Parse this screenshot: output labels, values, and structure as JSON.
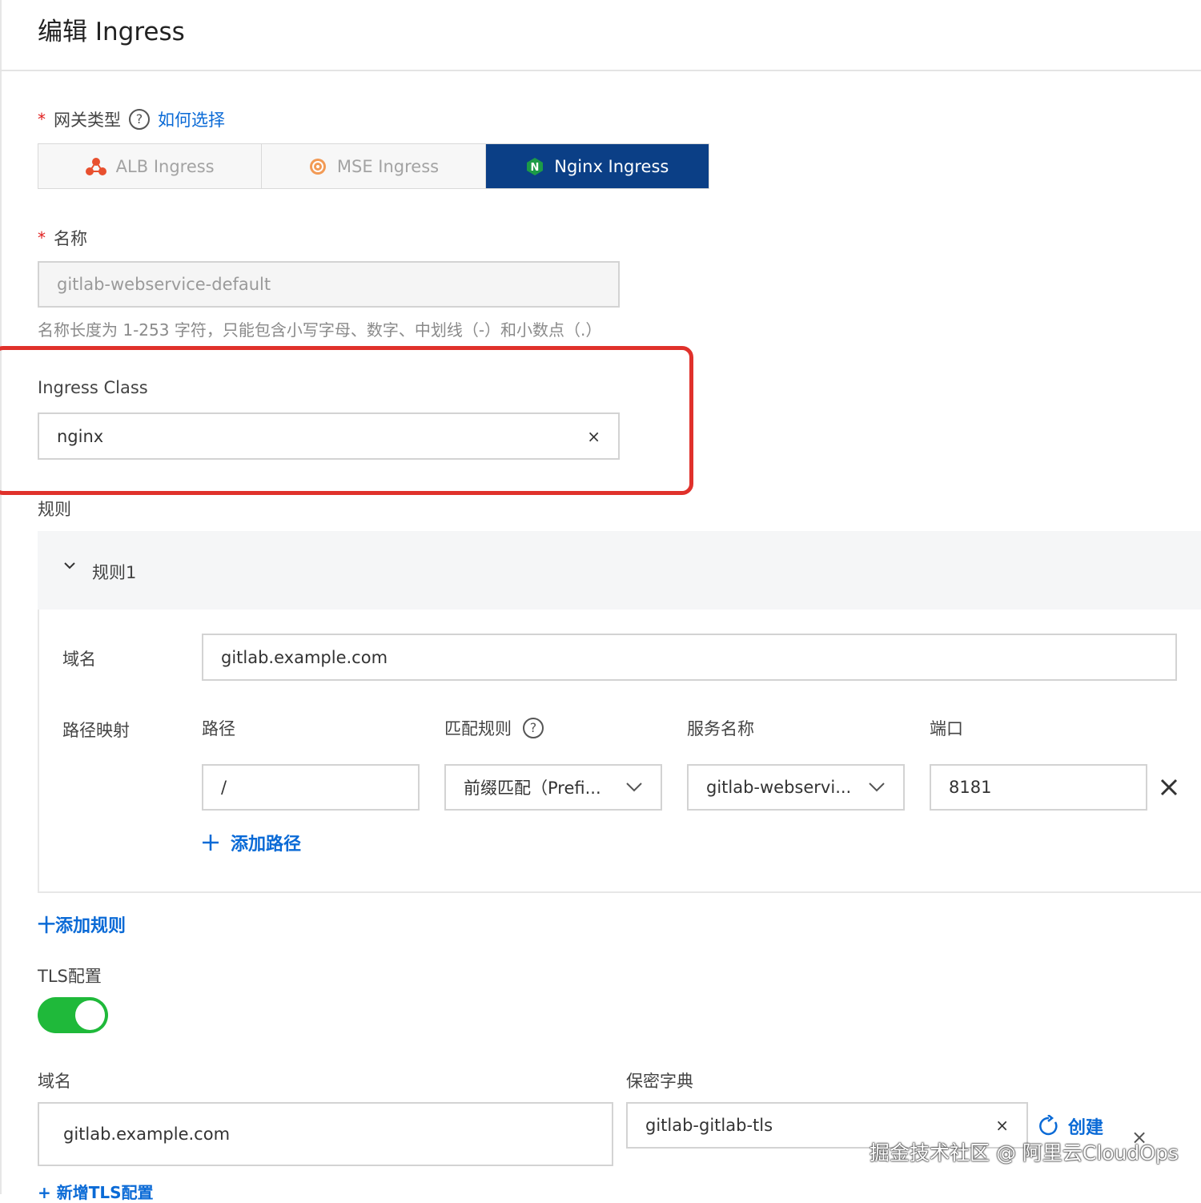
{
  "header": {
    "title": "编辑 Ingress"
  },
  "gateway": {
    "required_mark": "*",
    "label": "网关类型",
    "help_link": "如何选择",
    "tabs": [
      {
        "label": "ALB Ingress",
        "icon": "alb-icon",
        "active": false
      },
      {
        "label": "MSE Ingress",
        "icon": "mse-icon",
        "active": false
      },
      {
        "label": "Nginx Ingress",
        "icon": "nginx-icon",
        "active": true
      }
    ]
  },
  "name": {
    "required_mark": "*",
    "label": "名称",
    "value": "gitlab-webservice-default",
    "hint": "名称长度为 1-253 字符，只能包含小写字母、数字、中划线（-）和小数点（.）"
  },
  "ingress_class": {
    "label": "Ingress Class",
    "value": "nginx",
    "clear": "×"
  },
  "rules": {
    "label": "规则",
    "items": [
      {
        "title": "规则1",
        "domain_label": "域名",
        "domain_value": "gitlab.example.com",
        "path_mapping_label": "路径映射",
        "columns": {
          "path": "路径",
          "match": "匹配规则",
          "service": "服务名称",
          "port": "端口"
        },
        "paths": [
          {
            "path": "/",
            "match": "前缀匹配（Prefi...",
            "service": "gitlab-webservi...",
            "port": "8181"
          }
        ],
        "add_path": "添加路径"
      }
    ],
    "add_rule": "十添加规则"
  },
  "tls": {
    "label": "TLS配置",
    "enabled": true,
    "domain_label": "域名",
    "domain_value": "gitlab.example.com",
    "secret_label": "保密字典",
    "secret_value": "gitlab-gitlab-tls",
    "secret_clear": "×",
    "create": "创建",
    "remove": "×",
    "add_tls": "+ 新增TLS配置"
  },
  "watermark": "掘金技术社区 @ 阿里云CloudOps",
  "colors": {
    "primary": "#0a6ad6",
    "active_tab": "#0b3f86",
    "toggle_on": "#1fb93a",
    "highlight": "#e0312b",
    "required": "#e02020"
  }
}
